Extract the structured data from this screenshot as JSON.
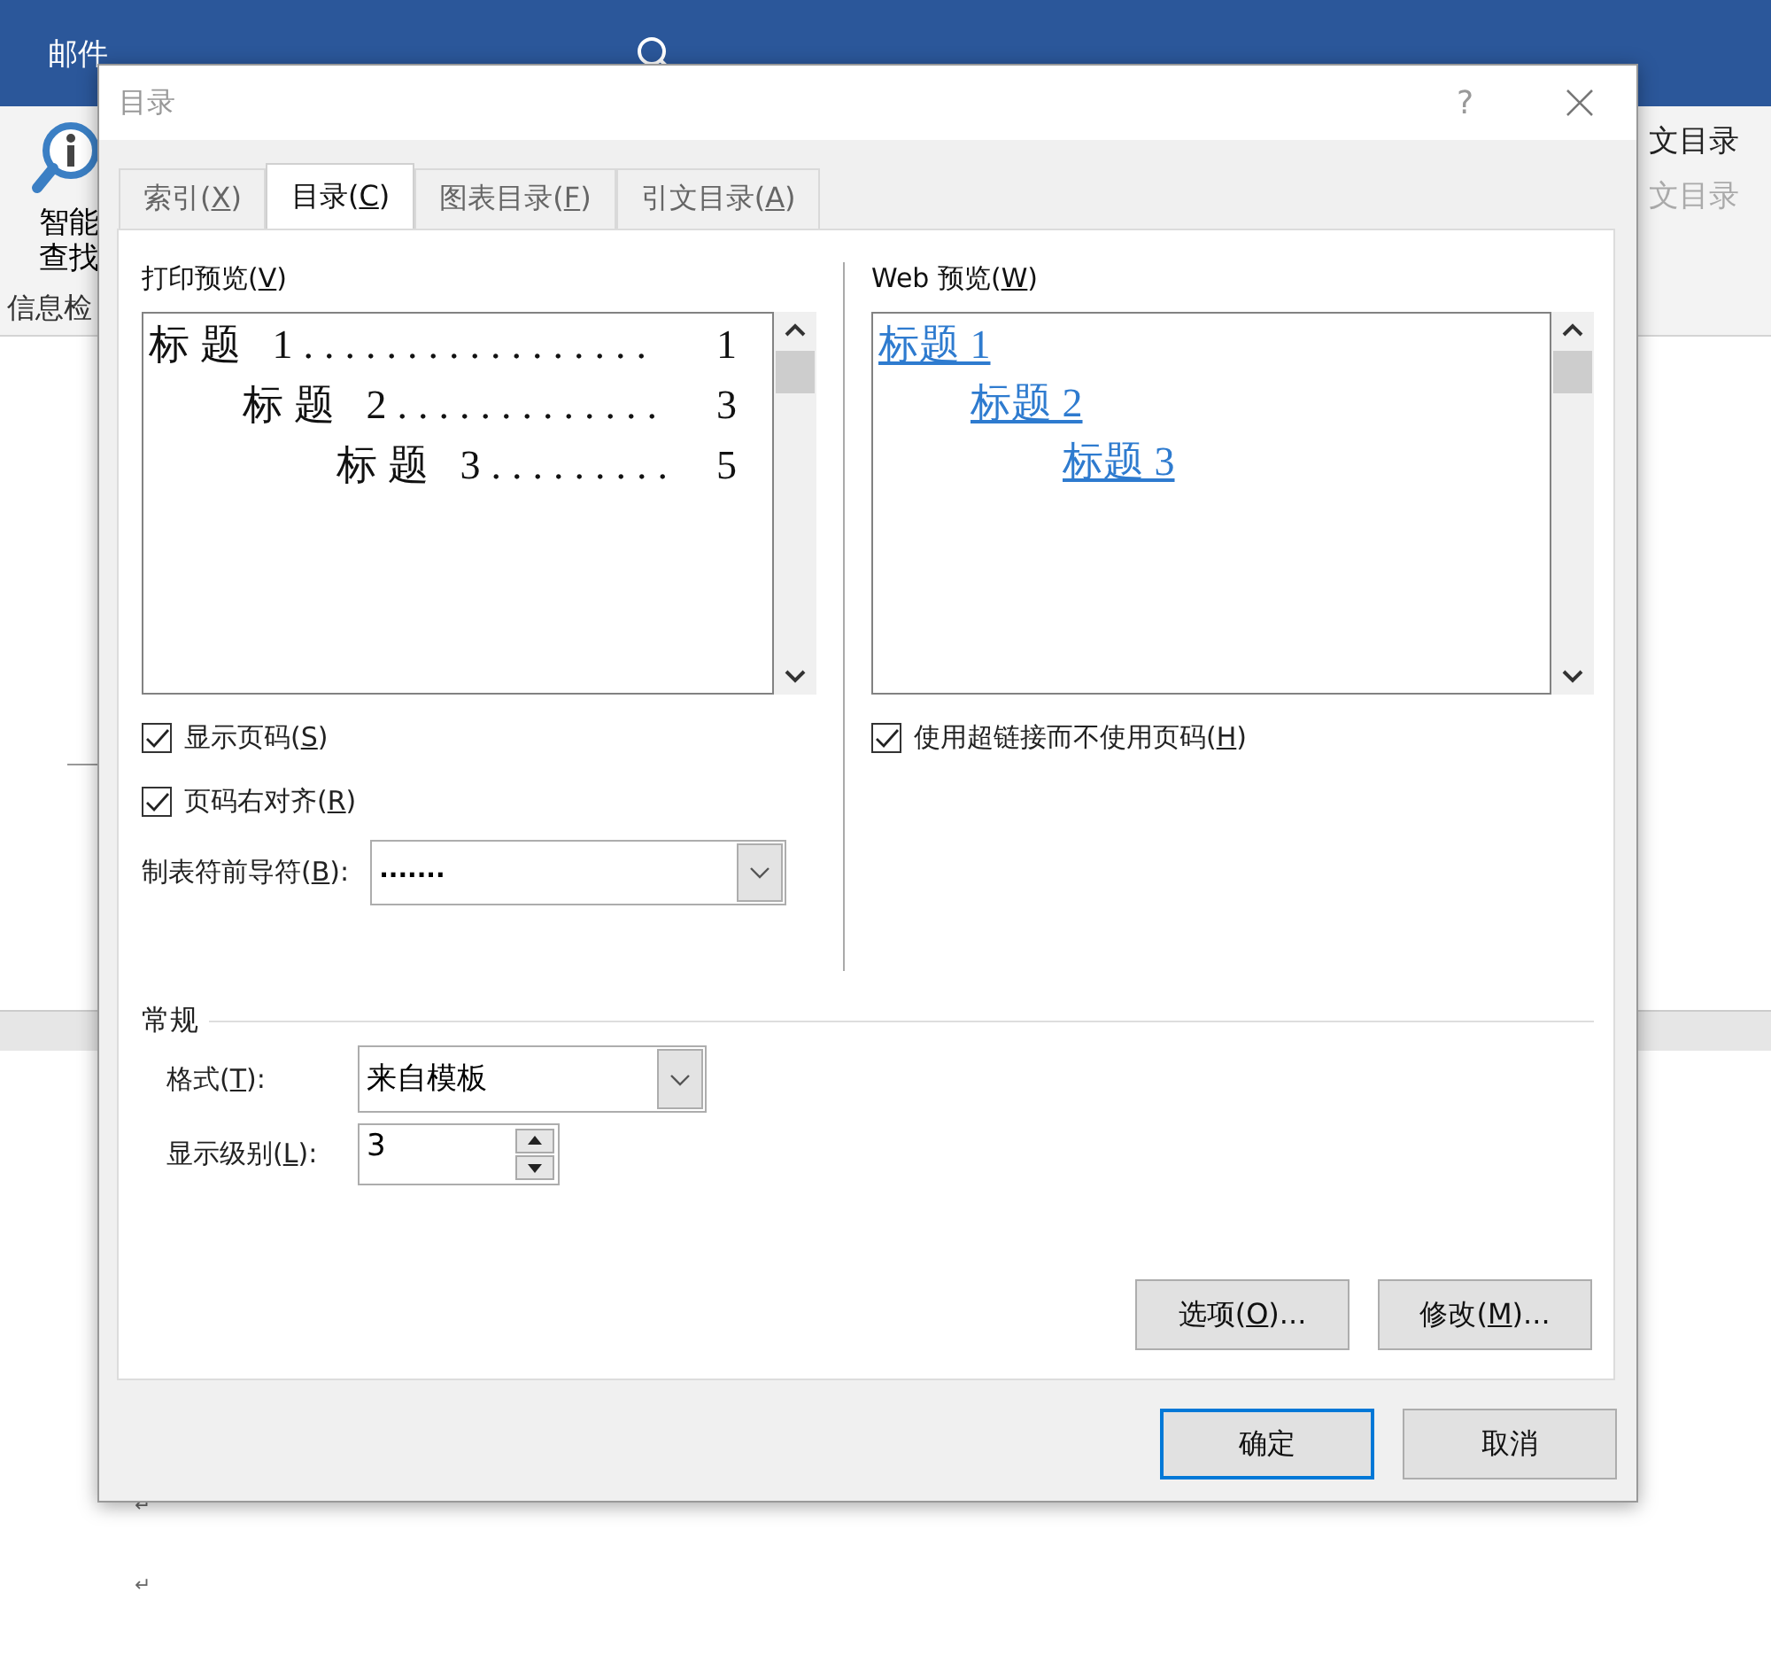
{
  "app": {
    "ribbon_tabs": [
      {
        "label": "邮件",
        "selected": true
      }
    ],
    "smart_lookup": {
      "lines": [
        "智能",
        "查找"
      ],
      "group": "信息检"
    },
    "ribbon_right": [
      {
        "label": "文目录",
        "disabled": false
      },
      {
        "label": "文目录",
        "disabled": true
      }
    ]
  },
  "document": {
    "paragraph_marks": [
      "↵",
      "↵"
    ]
  },
  "dialog": {
    "title": "目录",
    "help": "?",
    "tabs": [
      {
        "label": {
          "before": "索引(",
          "key": "X",
          "after": ")"
        },
        "selected": false
      },
      {
        "label": {
          "before": "目录(",
          "key": "C",
          "after": ")"
        },
        "selected": true
      },
      {
        "label": {
          "before": "图表目录(",
          "key": "F",
          "after": ")"
        },
        "selected": false
      },
      {
        "label": {
          "before": "引文目录(",
          "key": "A",
          "after": ")"
        },
        "selected": false
      }
    ],
    "print_preview": {
      "label": {
        "before": "打印预览(",
        "key": "V",
        "after": ")"
      },
      "entries": [
        {
          "text": "标题 1.................",
          "page": "1",
          "children": [
            {
              "text": "标题 2.............",
              "page": "3",
              "children": [
                {
                  "text": "标题 3.........",
                  "page": "5"
                }
              ]
            }
          ]
        }
      ]
    },
    "web_preview": {
      "label": {
        "before": "Web 预览(",
        "key": "W",
        "after": ")"
      },
      "entries": [
        {
          "text": "标题 1",
          "children": [
            {
              "text": "标题 2",
              "children": [
                {
                  "text": "标题 3"
                }
              ]
            }
          ]
        }
      ]
    },
    "left_options": [
      {
        "label": {
          "before": "显示页码(",
          "key": "S",
          "after": ")"
        },
        "checked": true
      },
      {
        "label": {
          "before": "页码右对齐(",
          "key": "R",
          "after": ")"
        },
        "checked": true
      }
    ],
    "tab_leader": {
      "label": {
        "before": "制表符前导符(",
        "key": "B",
        "after": "):"
      },
      "value": "......."
    },
    "web_options": [
      {
        "label": {
          "before": "使用超链接而不使用页码(",
          "key": "H",
          "after": ")"
        },
        "checked": true
      }
    ],
    "general": {
      "title": "常规",
      "format": {
        "label": {
          "before": "格式(",
          "key": "T",
          "after": "):"
        },
        "value": "来自模板"
      },
      "levels": {
        "label": {
          "before": "显示级别(",
          "key": "L",
          "after": "):"
        },
        "value": "3"
      }
    },
    "panel_buttons": [
      {
        "label": {
          "before": "选项(",
          "key": "O",
          "after": ")..."
        }
      },
      {
        "label": {
          "before": "修改(",
          "key": "M",
          "after": ")..."
        }
      }
    ],
    "buttons": [
      {
        "label": "确定",
        "default": true
      },
      {
        "label": "取消",
        "default": false
      }
    ]
  }
}
